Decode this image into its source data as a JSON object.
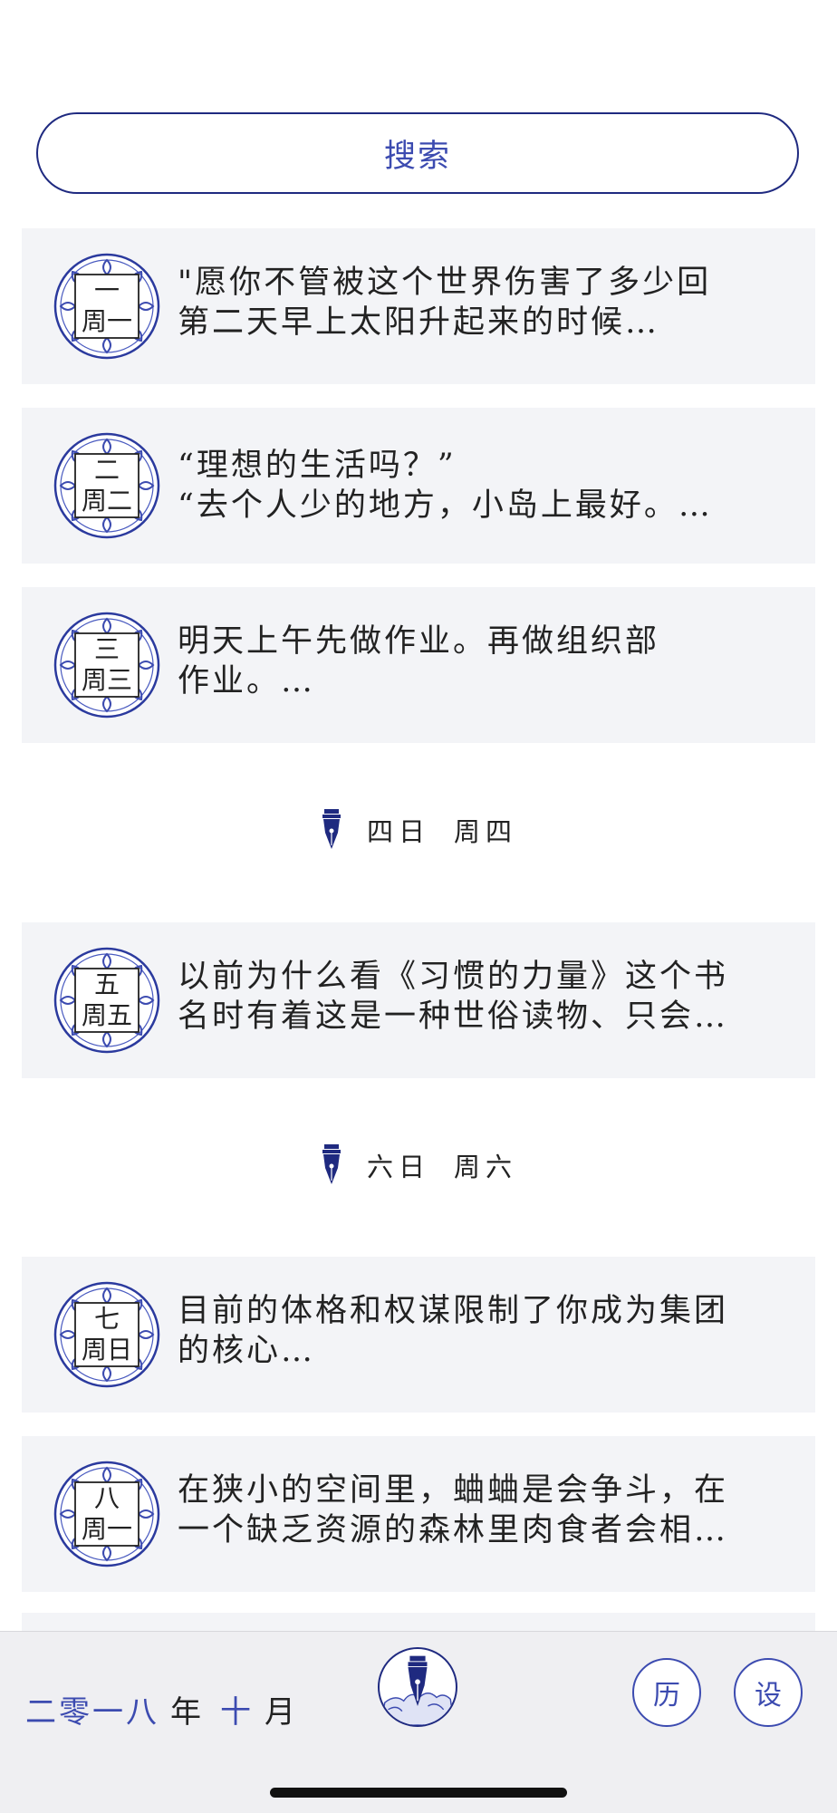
{
  "search": {
    "label": "搜索"
  },
  "entries": [
    {
      "day": "一",
      "weekday": "周一",
      "text": "\"愿你不管被这个世界伤害了多少回\n第二天早上太阳升起来的时候…"
    },
    {
      "day": "二",
      "weekday": "周二",
      "text": " “理想的生活吗？”\n “去个人少的地方，小岛上最好。…"
    },
    {
      "day": "三",
      "weekday": "周三",
      "text": "明天上午先做作业。再做组织部\n作业。…"
    },
    {
      "day": "五",
      "weekday": "周五",
      "text": "以前为什么看《习惯的力量》这个书\n名时有着这是一种世俗读物、只会…"
    },
    {
      "day": "七",
      "weekday": "周日",
      "text": "目前的体格和权谋限制了你成为集团\n的核心…"
    },
    {
      "day": "八",
      "weekday": "周一",
      "text": "在狭小的空间里，蛐蛐是会争斗，在\n一个缺乏资源的森林里肉食者会相…"
    }
  ],
  "empty_days": [
    {
      "date": "四日",
      "weekday": "周四"
    },
    {
      "date": "六日",
      "weekday": "周六"
    }
  ],
  "footer": {
    "year": "二零一八",
    "year_unit": "年",
    "month": "十",
    "month_unit": "月",
    "calendar_label": "历",
    "settings_label": "设"
  },
  "colors": {
    "accent": "#3c4bb0",
    "dark_blue": "#1f2a80",
    "card_bg": "#f3f4f7"
  },
  "icons": {
    "seal": "porcelain-seal-icon",
    "pen": "fountain-pen-icon"
  }
}
